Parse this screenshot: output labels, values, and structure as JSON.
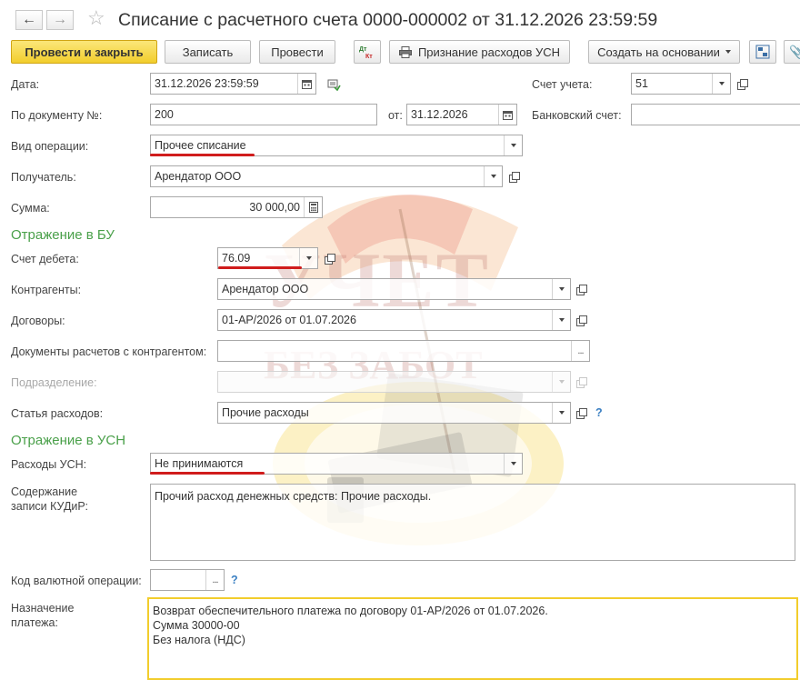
{
  "window": {
    "title": "Списание с расчетного счета 0000-000002 от 31.12.2026 23:59:59",
    "back_icon": "arrow-left-icon",
    "forward_icon": "arrow-right-icon",
    "favorite_icon": "star-icon"
  },
  "toolbar": {
    "post_close": "Провести и закрыть",
    "save": "Записать",
    "post": "Провести",
    "dt_kt_icon": "Дт Кт",
    "usn_recognition": "Признание расходов УСН",
    "create_based_on": "Создать на основании"
  },
  "fields": {
    "date_label": "Дата:",
    "date_value": "31.12.2026 23:59:59",
    "account_label": "Счет учета:",
    "account_value": "51",
    "doc_number_label": "По документу №:",
    "doc_number_value": "200",
    "doc_date_label": "от:",
    "doc_date_value": "31.12.2026",
    "bank_account_label": "Банковский счет:",
    "bank_account_value": "",
    "operation_label": "Вид операции:",
    "operation_value": "Прочее списание",
    "recipient_label": "Получатель:",
    "recipient_value": "Арендатор ООО",
    "amount_label": "Сумма:",
    "amount_value": "30 000,00"
  },
  "bu": {
    "section_title": "Отражение в БУ",
    "debit_label": "Счет дебета:",
    "debit_value": "76.09",
    "counterparties_label": "Контрагенты:",
    "counterparties_value": "Арендатор ООО",
    "contracts_label": "Договоры:",
    "contracts_value": "01-АР/2026 от 01.07.2026",
    "settlement_docs_label": "Документы расчетов с контрагентом:",
    "settlement_docs_value": "",
    "division_label": "Подразделение:",
    "division_value": "",
    "expense_item_label": "Статья расходов:",
    "expense_item_value": "Прочие расходы",
    "help": "?"
  },
  "usn": {
    "section_title": "Отражение в УСН",
    "expenses_label": "Расходы УСН:",
    "expenses_value": "Не принимаются",
    "kudir_label_line1": "Содержание",
    "kudir_label_line2": "записи КУДиР:",
    "kudir_value": "Прочий расход денежных средств: Прочие расходы."
  },
  "currency": {
    "label": "Код валютной операции:",
    "value": "",
    "help": "?"
  },
  "payment_purpose": {
    "label_line1": "Назначение",
    "label_line2": "платежа:",
    "lines": [
      "Возврат обеспечительного платежа по договору 01-АР/2026 от 01.07.2026.",
      "Сумма 30000-00",
      "Без налога (НДС)"
    ]
  },
  "watermark": {
    "line1": "УЧЕТ",
    "line2": "БЕЗ ЗАБОТ"
  },
  "colors": {
    "primary_button": "#f2cd2c",
    "section_title": "#4aa04a",
    "underline": "#d01c1c",
    "help": "#3a7fc2"
  }
}
